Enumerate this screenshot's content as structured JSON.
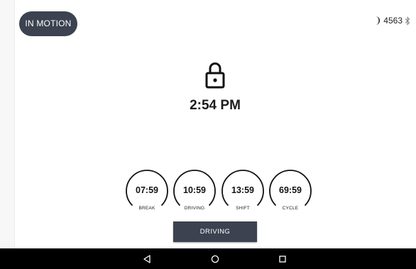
{
  "status": {
    "mode_label": "IN MOTION",
    "unit_number": "4563",
    "night_mode_icon": "moon-icon",
    "bluetooth_icon": "bluetooth-icon"
  },
  "lock": {
    "icon": "lock-icon",
    "time": "2:54 PM"
  },
  "clocks": [
    {
      "value": "07:59",
      "label": "BREAK"
    },
    {
      "value": "10:59",
      "label": "DRIVING"
    },
    {
      "value": "13:59",
      "label": "SHIFT"
    },
    {
      "value": "69:59",
      "label": "CYCLE"
    }
  ],
  "duty_status": {
    "button_label": "DRIVING"
  },
  "navigation": {
    "back_icon": "back-icon",
    "home_icon": "home-icon",
    "recents_icon": "recents-icon"
  },
  "colors": {
    "accent": "#3c4250",
    "nav_bar": "#000000",
    "background": "#ffffff"
  }
}
